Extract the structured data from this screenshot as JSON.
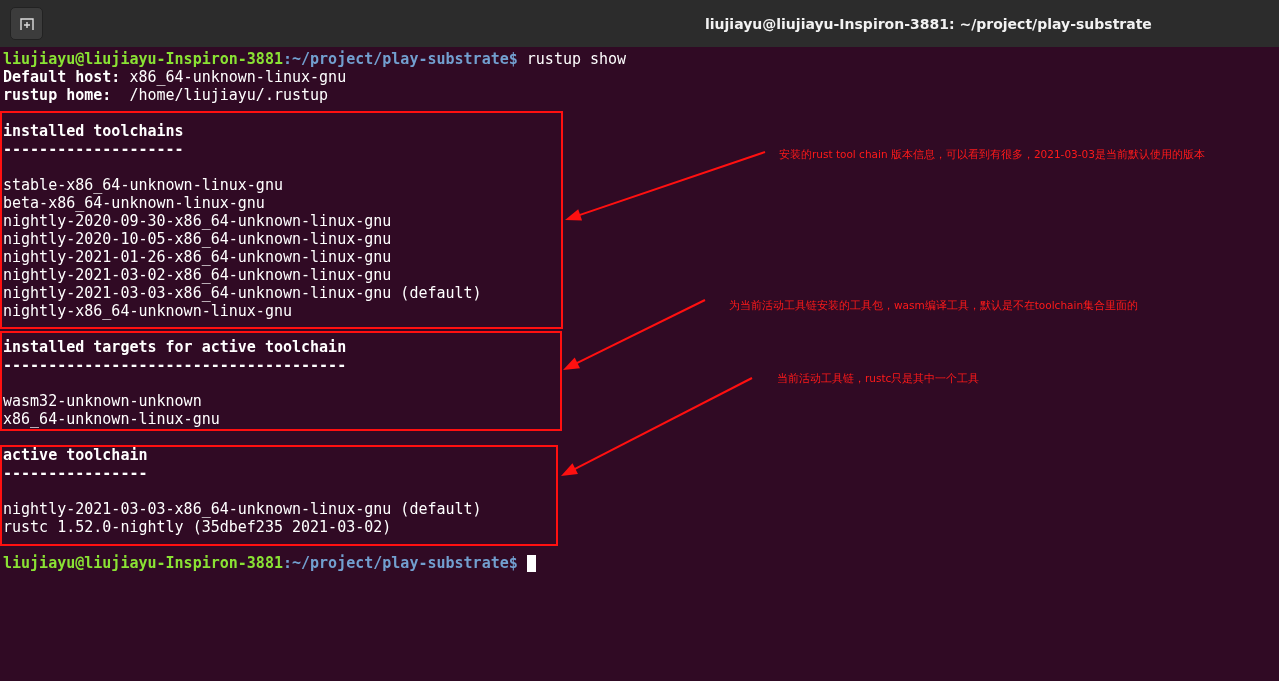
{
  "window": {
    "title": "liujiayu@liujiayu-Inspiron-3881: ~/project/play-substrate"
  },
  "terminal": {
    "lines": [
      {
        "kind": "prompt",
        "user_host": "liujiayu@liujiayu-Inspiron-3881",
        "path": ":~/project/play-substrate$",
        "command": "rustup show",
        "cursor": false
      },
      {
        "kind": "field",
        "label": "Default host:",
        "value": "x86_64-unknown-linux-gnu"
      },
      {
        "kind": "field",
        "label": "rustup home:",
        "value": " /home/liujiayu/.rustup"
      },
      {
        "kind": "blank"
      },
      {
        "kind": "heading",
        "text": "installed toolchains"
      },
      {
        "kind": "heading",
        "text": "--------------------"
      },
      {
        "kind": "blank"
      },
      {
        "kind": "text",
        "text": "stable-x86_64-unknown-linux-gnu"
      },
      {
        "kind": "text",
        "text": "beta-x86_64-unknown-linux-gnu"
      },
      {
        "kind": "text",
        "text": "nightly-2020-09-30-x86_64-unknown-linux-gnu"
      },
      {
        "kind": "text",
        "text": "nightly-2020-10-05-x86_64-unknown-linux-gnu"
      },
      {
        "kind": "text",
        "text": "nightly-2021-01-26-x86_64-unknown-linux-gnu"
      },
      {
        "kind": "text",
        "text": "nightly-2021-03-02-x86_64-unknown-linux-gnu"
      },
      {
        "kind": "text",
        "text": "nightly-2021-03-03-x86_64-unknown-linux-gnu (default)"
      },
      {
        "kind": "text",
        "text": "nightly-x86_64-unknown-linux-gnu"
      },
      {
        "kind": "blank"
      },
      {
        "kind": "heading",
        "text": "installed targets for active toolchain"
      },
      {
        "kind": "heading",
        "text": "--------------------------------------"
      },
      {
        "kind": "blank"
      },
      {
        "kind": "text",
        "text": "wasm32-unknown-unknown"
      },
      {
        "kind": "text",
        "text": "x86_64-unknown-linux-gnu"
      },
      {
        "kind": "blank"
      },
      {
        "kind": "heading",
        "text": "active toolchain"
      },
      {
        "kind": "heading",
        "text": "----------------"
      },
      {
        "kind": "blank"
      },
      {
        "kind": "text",
        "text": "nightly-2021-03-03-x86_64-unknown-linux-gnu (default)"
      },
      {
        "kind": "text",
        "text": "rustc 1.52.0-nightly (35dbef235 2021-03-02)"
      },
      {
        "kind": "blank"
      },
      {
        "kind": "prompt",
        "user_host": "liujiayu@liujiayu-Inspiron-3881",
        "path": ":~/project/play-substrate$",
        "cursor": true
      }
    ]
  },
  "annotations": [
    {
      "text": "安装的rust tool chain 版本信息，可以看到有很多，2021-03-03是当前默认使用的版本"
    },
    {
      "text": "为当前活动工具链安装的工具包，wasm编译工具，默认是不在toolchain集合里面的"
    },
    {
      "text": "当前活动工具链，rustc只是其中一个工具"
    }
  ]
}
